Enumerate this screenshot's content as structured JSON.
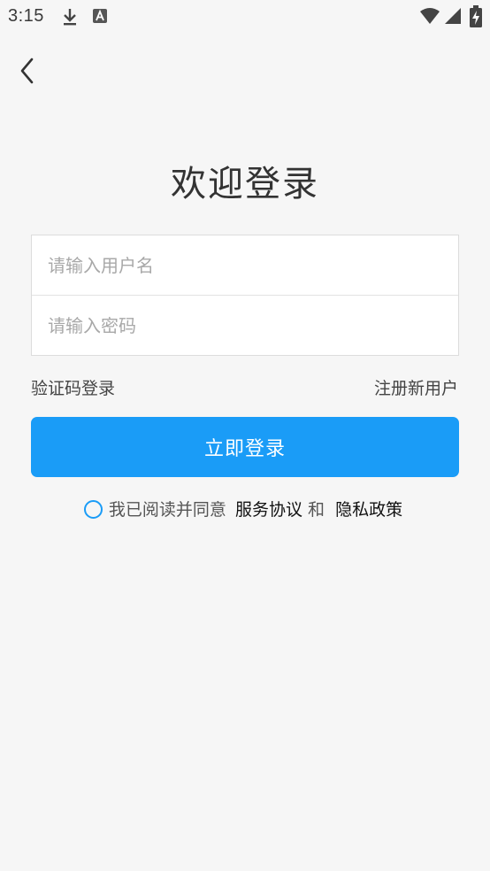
{
  "status_bar": {
    "time": "3:15",
    "icons": [
      "download-icon",
      "a-icon",
      "wifi-icon",
      "signal-icon",
      "battery-charging-icon"
    ]
  },
  "header": {
    "back_icon": "chevron-left-icon"
  },
  "title": "欢迎登录",
  "form": {
    "username_placeholder": "请输入用户名",
    "username_value": "",
    "password_placeholder": "请输入密码",
    "password_value": ""
  },
  "links": {
    "sms_login": "验证码登录",
    "register": "注册新用户"
  },
  "login_button": "立即登录",
  "agreement": {
    "checked": false,
    "prefix": "我已阅读并同意",
    "terms": "服务协议",
    "and": "和",
    "privacy": "隐私政策"
  },
  "colors": {
    "accent": "#1a9cf7",
    "background": "#f6f6f6"
  }
}
